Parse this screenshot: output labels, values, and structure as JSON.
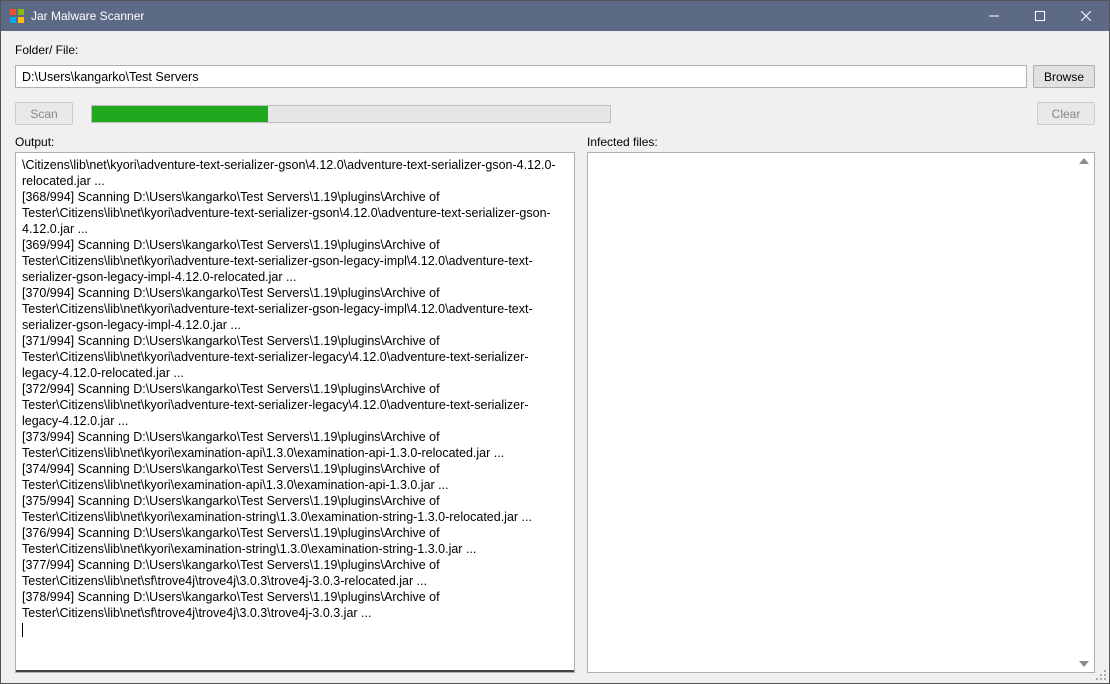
{
  "title": "Jar Malware Scanner",
  "folder_label": "Folder/ File:",
  "path_value": "D:\\Users\\kangarko\\Test Servers",
  "browse_label": "Browse",
  "scan_label": "Scan",
  "clear_label": "Clear",
  "output_label": "Output:",
  "infected_label": "Infected files:",
  "progress_percent": 34,
  "output_lines": [
    "\\Citizens\\lib\\net\\kyori\\adventure-text-serializer-gson\\4.12.0\\adventure-text-serializer-gson-4.12.0-relocated.jar ...",
    "[368/994] Scanning D:\\Users\\kangarko\\Test Servers\\1.19\\plugins\\Archive of Tester\\Citizens\\lib\\net\\kyori\\adventure-text-serializer-gson\\4.12.0\\adventure-text-serializer-gson-4.12.0.jar ...",
    "[369/994] Scanning D:\\Users\\kangarko\\Test Servers\\1.19\\plugins\\Archive of Tester\\Citizens\\lib\\net\\kyori\\adventure-text-serializer-gson-legacy-impl\\4.12.0\\adventure-text-serializer-gson-legacy-impl-4.12.0-relocated.jar ...",
    "[370/994] Scanning D:\\Users\\kangarko\\Test Servers\\1.19\\plugins\\Archive of Tester\\Citizens\\lib\\net\\kyori\\adventure-text-serializer-gson-legacy-impl\\4.12.0\\adventure-text-serializer-gson-legacy-impl-4.12.0.jar ...",
    "[371/994] Scanning D:\\Users\\kangarko\\Test Servers\\1.19\\plugins\\Archive of Tester\\Citizens\\lib\\net\\kyori\\adventure-text-serializer-legacy\\4.12.0\\adventure-text-serializer-legacy-4.12.0-relocated.jar ...",
    "[372/994] Scanning D:\\Users\\kangarko\\Test Servers\\1.19\\plugins\\Archive of Tester\\Citizens\\lib\\net\\kyori\\adventure-text-serializer-legacy\\4.12.0\\adventure-text-serializer-legacy-4.12.0.jar ...",
    "[373/994] Scanning D:\\Users\\kangarko\\Test Servers\\1.19\\plugins\\Archive of Tester\\Citizens\\lib\\net\\kyori\\examination-api\\1.3.0\\examination-api-1.3.0-relocated.jar ...",
    "[374/994] Scanning D:\\Users\\kangarko\\Test Servers\\1.19\\plugins\\Archive of Tester\\Citizens\\lib\\net\\kyori\\examination-api\\1.3.0\\examination-api-1.3.0.jar ...",
    "[375/994] Scanning D:\\Users\\kangarko\\Test Servers\\1.19\\plugins\\Archive of Tester\\Citizens\\lib\\net\\kyori\\examination-string\\1.3.0\\examination-string-1.3.0-relocated.jar ...",
    "[376/994] Scanning D:\\Users\\kangarko\\Test Servers\\1.19\\plugins\\Archive of Tester\\Citizens\\lib\\net\\kyori\\examination-string\\1.3.0\\examination-string-1.3.0.jar ...",
    "[377/994] Scanning D:\\Users\\kangarko\\Test Servers\\1.19\\plugins\\Archive of Tester\\Citizens\\lib\\net\\sf\\trove4j\\trove4j\\3.0.3\\trove4j-3.0.3-relocated.jar ...",
    "[378/994] Scanning D:\\Users\\kangarko\\Test Servers\\1.19\\plugins\\Archive of Tester\\Citizens\\lib\\net\\sf\\trove4j\\trove4j\\3.0.3\\trove4j-3.0.3.jar ..."
  ],
  "infected_lines": []
}
